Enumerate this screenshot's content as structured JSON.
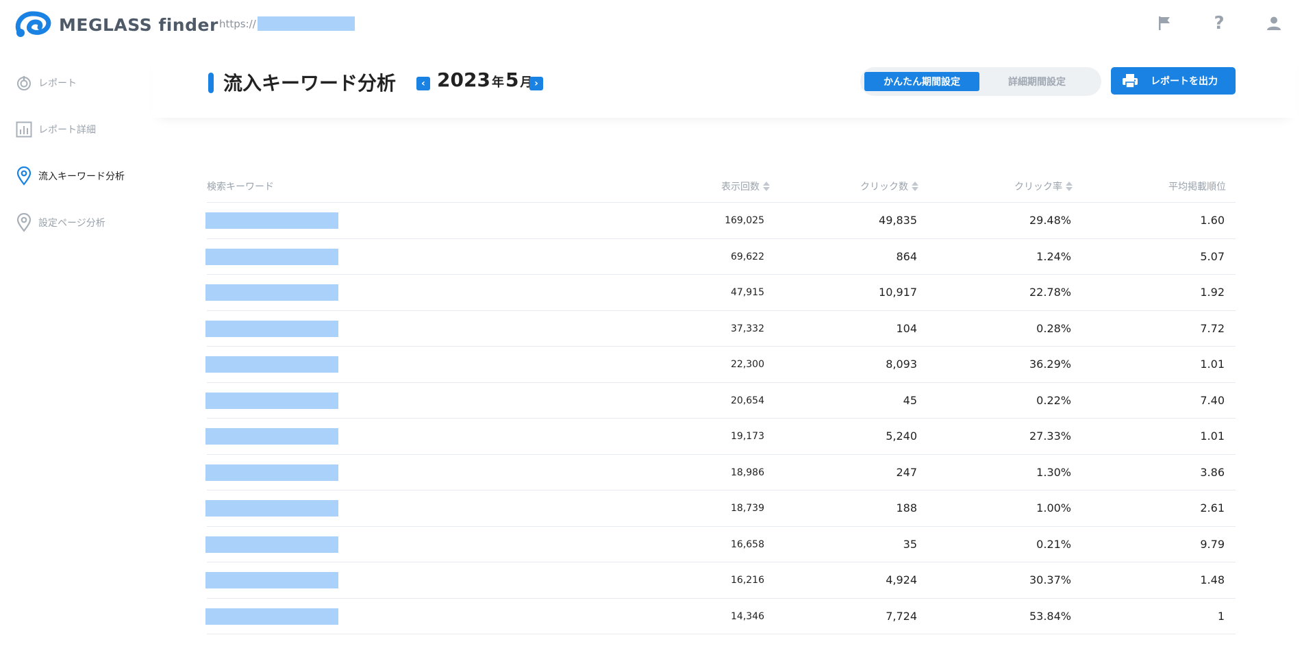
{
  "app": {
    "logo_text": "MEGLASS finder",
    "site_url_prefix": "https://",
    "accent_color": "#1a82e2"
  },
  "topbar": {
    "icons": [
      "flag-icon",
      "help-icon",
      "user-icon"
    ],
    "help_glyph": "?"
  },
  "sidebar": {
    "items": [
      {
        "label": "レポート",
        "icon": "dial-icon",
        "active": false
      },
      {
        "label": "レポート詳細",
        "icon": "bar-chart-icon",
        "active": false
      },
      {
        "label": "流入キーワード分析",
        "icon": "map-pin-icon",
        "active": true
      },
      {
        "label": "設定ページ分析",
        "icon": "map-pin-icon",
        "active": false
      }
    ]
  },
  "header": {
    "title": "流入キーワード分析",
    "year": "2023",
    "year_unit": "年",
    "month": "5",
    "month_unit": "月",
    "prev_glyph": "‹",
    "next_glyph": "›",
    "toggle": {
      "simple": "かんたん期間設定",
      "detailed": "詳細期間設定"
    },
    "export_label": "レポートを出力"
  },
  "table": {
    "columns": {
      "keyword": "検索キーワード",
      "impressions": "表示回数",
      "clicks": "クリック数",
      "ctr": "クリック率",
      "avg_position": "平均掲載順位"
    },
    "rows": [
      {
        "impressions": "169,025",
        "clicks": "49,835",
        "ctr": "29.48%",
        "avg_position": "1.60"
      },
      {
        "impressions": "69,622",
        "clicks": "864",
        "ctr": "1.24%",
        "avg_position": "5.07"
      },
      {
        "impressions": "47,915",
        "clicks": "10,917",
        "ctr": "22.78%",
        "avg_position": "1.92"
      },
      {
        "impressions": "37,332",
        "clicks": "104",
        "ctr": "0.28%",
        "avg_position": "7.72"
      },
      {
        "impressions": "22,300",
        "clicks": "8,093",
        "ctr": "36.29%",
        "avg_position": "1.01"
      },
      {
        "impressions": "20,654",
        "clicks": "45",
        "ctr": "0.22%",
        "avg_position": "7.40"
      },
      {
        "impressions": "19,173",
        "clicks": "5,240",
        "ctr": "27.33%",
        "avg_position": "1.01"
      },
      {
        "impressions": "18,986",
        "clicks": "247",
        "ctr": "1.30%",
        "avg_position": "3.86"
      },
      {
        "impressions": "18,739",
        "clicks": "188",
        "ctr": "1.00%",
        "avg_position": "2.61"
      },
      {
        "impressions": "16,658",
        "clicks": "35",
        "ctr": "0.21%",
        "avg_position": "9.79"
      },
      {
        "impressions": "16,216",
        "clicks": "4,924",
        "ctr": "30.37%",
        "avg_position": "1.48"
      },
      {
        "impressions": "14,346",
        "clicks": "7,724",
        "ctr": "53.84%",
        "avg_position": "1"
      }
    ]
  }
}
